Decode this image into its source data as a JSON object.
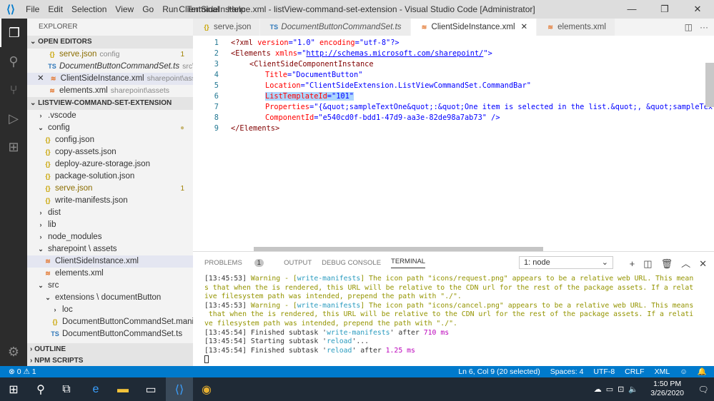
{
  "titlebar": {
    "menu": [
      "File",
      "Edit",
      "Selection",
      "View",
      "Go",
      "Run",
      "Terminal",
      "Help"
    ],
    "title": "ClientSideInstance.xml - listView-command-set-extension - Visual Studio Code [Administrator]"
  },
  "sidebar": {
    "title": "EXPLORER",
    "open_editors": "OPEN EDITORS",
    "open": [
      {
        "name": "serve.json",
        "desc": "config",
        "badge": "1",
        "type": "json"
      },
      {
        "name": "DocumentButtonCommandSet.ts",
        "desc": "src\\exte...",
        "type": "ts"
      },
      {
        "name": "ClientSideInstance.xml",
        "desc": "sharepoint\\assets",
        "type": "xml"
      },
      {
        "name": "elements.xml",
        "desc": "sharepoint\\assets",
        "type": "xml"
      }
    ],
    "project": "LISTVIEW-COMMAND-SET-EXTENSION",
    "tree": [
      {
        "name": ".vscode",
        "kind": "folder-closed",
        "depth": 1
      },
      {
        "name": "config",
        "kind": "folder-open",
        "depth": 1
      },
      {
        "name": "config.json",
        "kind": "json",
        "depth": 2
      },
      {
        "name": "copy-assets.json",
        "kind": "json",
        "depth": 2
      },
      {
        "name": "deploy-azure-storage.json",
        "kind": "json",
        "depth": 2
      },
      {
        "name": "package-solution.json",
        "kind": "json",
        "depth": 2
      },
      {
        "name": "serve.json",
        "kind": "json",
        "depth": 2,
        "badge": "1"
      },
      {
        "name": "write-manifests.json",
        "kind": "json",
        "depth": 2
      },
      {
        "name": "dist",
        "kind": "folder-closed",
        "depth": 1
      },
      {
        "name": "lib",
        "kind": "folder-closed",
        "depth": 1
      },
      {
        "name": "node_modules",
        "kind": "folder-closed",
        "depth": 1
      },
      {
        "name": "sharepoint \\ assets",
        "kind": "folder-open",
        "depth": 1
      },
      {
        "name": "ClientSideInstance.xml",
        "kind": "xml",
        "depth": 2
      },
      {
        "name": "elements.xml",
        "kind": "xml",
        "depth": 2
      },
      {
        "name": "src",
        "kind": "folder-open",
        "depth": 1
      },
      {
        "name": "extensions \\ documentButton",
        "kind": "folder-open",
        "depth": 2
      },
      {
        "name": "loc",
        "kind": "folder-closed",
        "depth": 3
      },
      {
        "name": "DocumentButtonCommandSet.manifest.j...",
        "kind": "json",
        "depth": 3
      },
      {
        "name": "DocumentButtonCommandSet.ts",
        "kind": "ts",
        "depth": 3
      }
    ],
    "outline": "OUTLINE",
    "npm": "NPM SCRIPTS"
  },
  "tabs": [
    {
      "label": "serve.json",
      "type": "json"
    },
    {
      "label": "DocumentButtonCommandSet.ts",
      "type": "ts"
    },
    {
      "label": "ClientSideInstance.xml",
      "type": "xml"
    },
    {
      "label": "elements.xml",
      "type": "xml"
    }
  ],
  "editor": {
    "line_numbers": [
      "1",
      "2",
      "3",
      "4",
      "5",
      "6",
      "7",
      "8",
      "9"
    ],
    "l1": [
      "<?xml ",
      "version",
      "=\"1.0\" ",
      "encoding",
      "=\"utf-8\"?>"
    ],
    "l2": [
      "<Elements ",
      "xmlns",
      "=\"",
      "http://schemas.microsoft.com/sharepoint/",
      "\">"
    ],
    "l3": "<ClientSideComponentInstance",
    "l4": [
      "Title",
      "=\"DocumentButton\""
    ],
    "l5": [
      "Location",
      "=\"ClientSideExtension.ListViewCommandSet.CommandBar\""
    ],
    "l6": [
      "ListTemplateId",
      "=\"101\""
    ],
    "l7": [
      "Properties",
      "=\"{&quot;sampleTextOne&quot;:&quot;One item is selected in the list.&quot;, &quot;sampleTextTwo"
    ],
    "l8": [
      "ComponentId",
      "=\"e540cd0f-bdd1-47d9-aa3e-82de98a7ab73\" />"
    ],
    "l9": "</Elements>"
  },
  "panel": {
    "tabs": [
      "PROBLEMS",
      "OUTPUT",
      "DEBUG CONSOLE",
      "TERMINAL"
    ],
    "problems_count": "1",
    "terminal_select": "1: node",
    "lines": [
      {
        "ts": "[13:45:53] ",
        "a": "Warning - [",
        "b": "write-manifests",
        "c": "] The icon path \"icons/request.png\" appears to be a relative web URL. This mean"
      },
      {
        "c": "s that when the is rendered, this URL will be relative to the CDN url for the rest of the package assets. If a relat"
      },
      {
        "c": "ive filesystem path was intended, prepend the path with \"./\"."
      },
      {
        "ts": "[13:45:53] ",
        "a": "Warning - [",
        "b": "write-manifests",
        "c": "] The icon path \"icons/cancel.png\" appears to be a relative web URL. This means"
      },
      {
        "c": " that when the is rendered, this URL will be relative to the CDN url for the rest of the package assets. If a relati"
      },
      {
        "c": "ve filesystem path was intended, prepend the path with \"./\"."
      }
    ],
    "f1": [
      "[13:45:54] Finished subtask '",
      "write-manifests",
      "' after ",
      "710 ms"
    ],
    "f2": [
      "[13:45:54] Starting subtask '",
      "reload",
      "'..."
    ],
    "f3": [
      "[13:45:54] Finished subtask '",
      "reload",
      "' after ",
      "1.25 ms"
    ]
  },
  "status": {
    "problems": "⊗ 0 ⚠ 1",
    "position": "Ln 6, Col 9 (20 selected)",
    "spaces": "Spaces: 4",
    "encoding": "UTF-8",
    "eol": "CRLF",
    "lang": "XML"
  },
  "taskbar": {
    "time": "1:50 PM",
    "date": "3/26/2020"
  }
}
